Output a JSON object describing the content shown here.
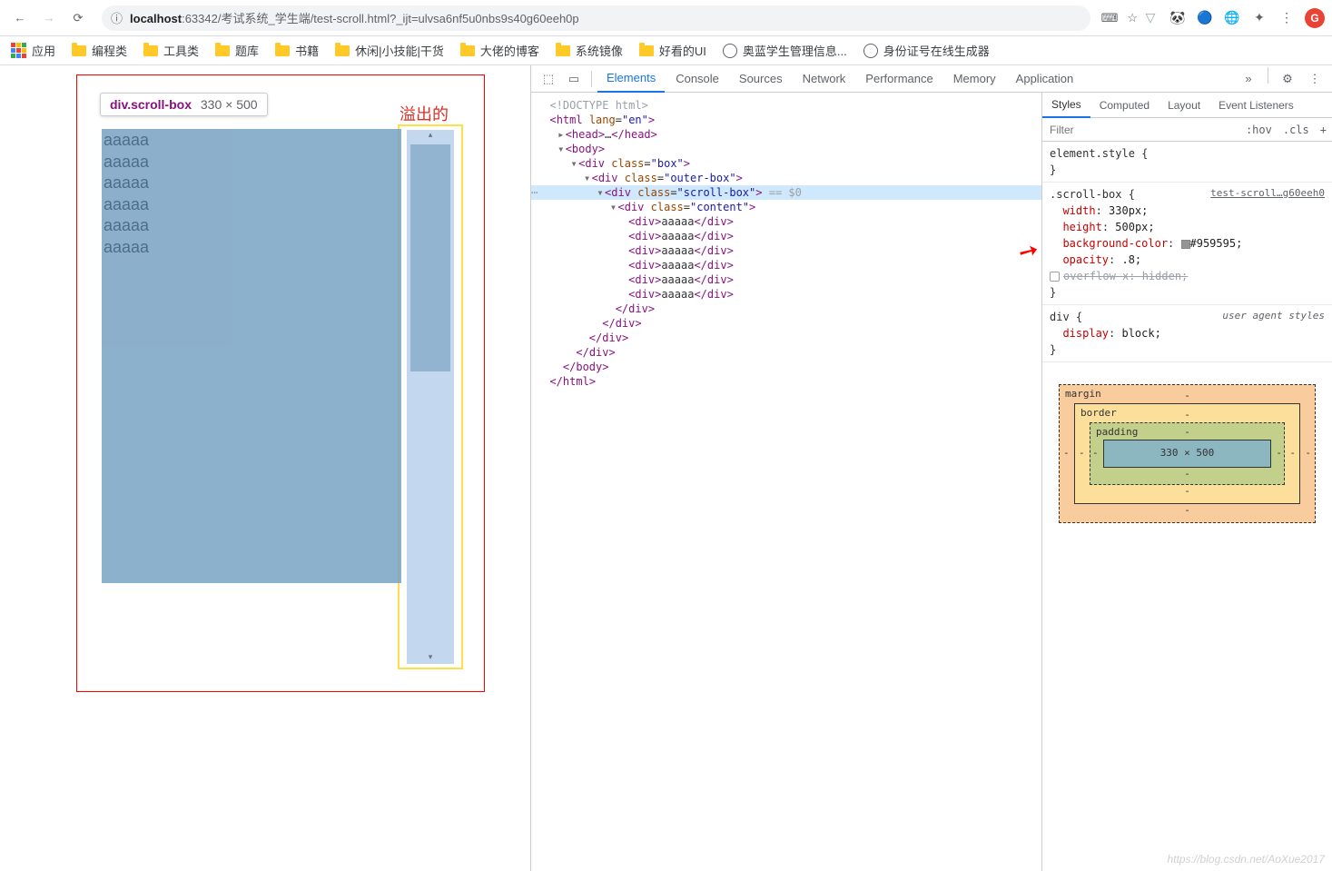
{
  "browser": {
    "url_host": "localhost",
    "url_rest": ":63342/考试系统_学生端/test-scroll.html?_ijt=ulvsa6nf5u0nbs9s40g60eeh0p",
    "avatar": "G"
  },
  "bookmarks": {
    "apps": "应用",
    "items": [
      "编程类",
      "工具类",
      "题库",
      "书籍",
      "休闲|小技能|干货",
      "大佬的博客",
      "系统镜像",
      "好看的UI"
    ],
    "link1": "奥蓝学生管理信息...",
    "link2": "身份证号在线生成器"
  },
  "preview": {
    "tooltip_selector": "div.scroll-box",
    "tooltip_dim": "330 × 500",
    "overflow_label": "溢出的",
    "lines": [
      "aaaaa",
      "aaaaa",
      "aaaaa",
      "aaaaa",
      "aaaaa",
      "aaaaa"
    ]
  },
  "devtools": {
    "tabs": [
      "Elements",
      "Console",
      "Sources",
      "Network",
      "Performance",
      "Memory",
      "Application"
    ],
    "active_tab": "Elements",
    "styles_tabs": [
      "Styles",
      "Computed",
      "Layout",
      "Event Listeners"
    ],
    "active_styles_tab": "Styles",
    "filter_placeholder": "Filter",
    "hov": ":hov",
    "cls": ".cls"
  },
  "dom": {
    "l0": "<!DOCTYPE html>",
    "l1_open": "<html ",
    "l1_attr": "lang",
    "l1_val": "\"en\"",
    "l1_close": ">",
    "l2": "<head>…</head>",
    "l3": "<body>",
    "l4": "<div class=\"box\">",
    "l5": "<div class=\"outer-box\">",
    "l6": "<div class=\"scroll-box\"> ",
    "l6_sel": "== $0",
    "l7": "<div class=\"content\">",
    "l8": "<div>aaaaa</div>",
    "l9": "</div>",
    "l10": "</body>",
    "l11": "</html>"
  },
  "styles": {
    "elstyle": "element.style {",
    "brace_close": "}",
    "rule_sel": ".scroll-box {",
    "rule_src": "test-scroll…g60eeh0",
    "p1": "width",
    "v1": "330px;",
    "p2": "height",
    "v2": "500px;",
    "p3": "background-color",
    "v3": "#959595;",
    "p4": "opacity",
    "v4": ".8;",
    "p5": "overflow-x",
    "v5": "hidden;",
    "div_rule": "div {",
    "ua": "user agent styles",
    "p6": "display",
    "v6": "block;"
  },
  "boxmodel": {
    "margin": "margin",
    "border": "border",
    "padding": "padding",
    "content": "330 × 500",
    "dash": "-"
  },
  "watermark": "https://blog.csdn.net/AoXue2017"
}
